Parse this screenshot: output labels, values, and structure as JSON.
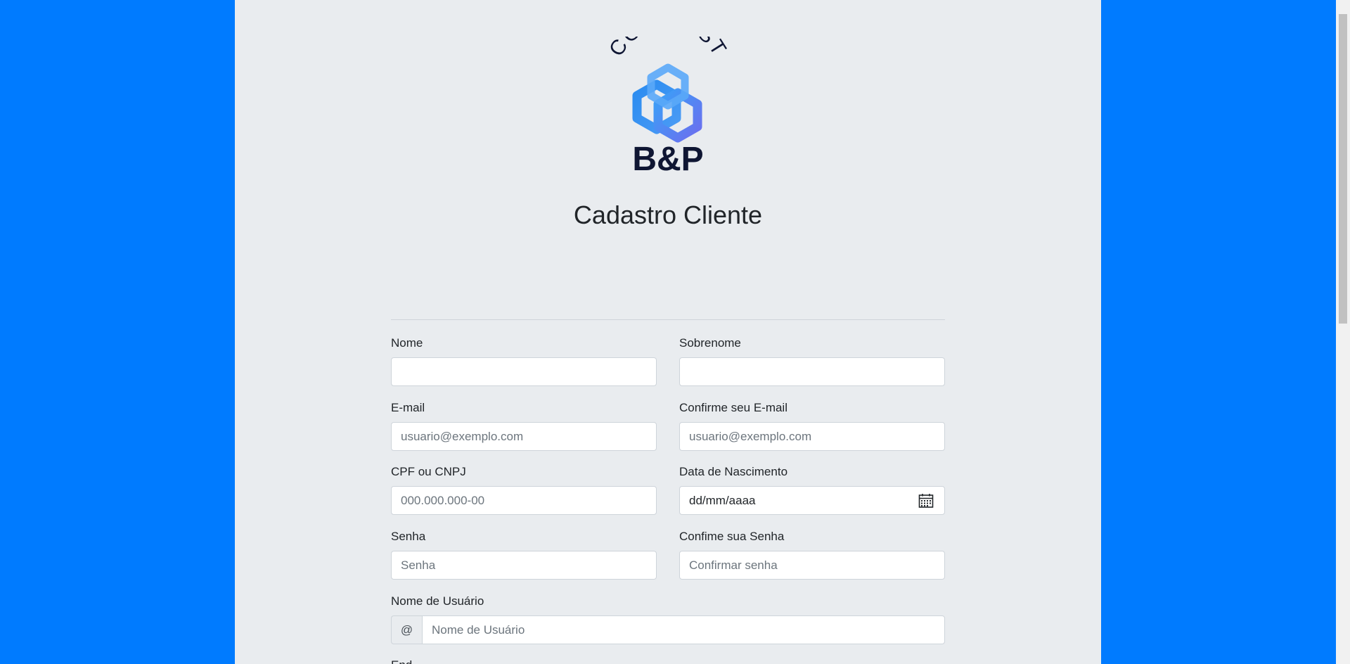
{
  "logo": {
    "brand_top": "COINVEST",
    "brand_bottom": "B&P"
  },
  "page_title": "Cadastro Cliente",
  "form": {
    "nome": {
      "label": "Nome",
      "value": "",
      "placeholder": ""
    },
    "sobrenome": {
      "label": "Sobrenome",
      "value": "",
      "placeholder": ""
    },
    "email": {
      "label": "E-mail",
      "placeholder": "usuario@exemplo.com"
    },
    "confirm_email": {
      "label": "Confirme seu E-mail",
      "placeholder": "usuario@exemplo.com"
    },
    "cpf": {
      "label": "CPF ou CNPJ",
      "placeholder": "000.000.000-00"
    },
    "nascimento": {
      "label": "Data de Nascimento",
      "value_text": "dd/mm/aaaa",
      "icon": "calendar-icon"
    },
    "senha": {
      "label": "Senha",
      "placeholder": "Senha"
    },
    "confirm_senha": {
      "label": "Confime sua Senha",
      "placeholder": "Confirmar senha"
    },
    "usuario": {
      "label": "Nome de Usuário",
      "prefix": "@",
      "placeholder": "Nome de Usuário"
    },
    "next_label_partial": "End"
  },
  "colors": {
    "page_background": "#007bff",
    "panel_background": "#e9ecef",
    "logo_dark": "#0f1633",
    "logo_blue": "#2b8cf0",
    "logo_purple": "#6b6fef"
  }
}
